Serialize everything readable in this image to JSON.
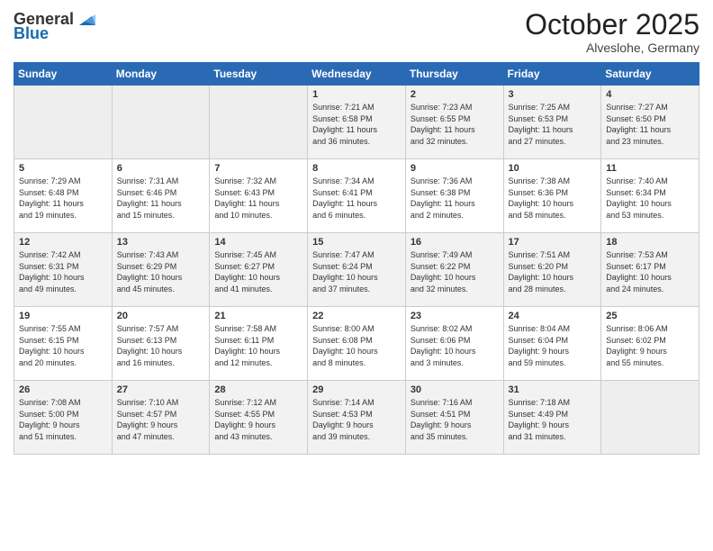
{
  "header": {
    "logo_general": "General",
    "logo_blue": "Blue",
    "month": "October 2025",
    "location": "Alveslohe, Germany"
  },
  "weekdays": [
    "Sunday",
    "Monday",
    "Tuesday",
    "Wednesday",
    "Thursday",
    "Friday",
    "Saturday"
  ],
  "weeks": [
    [
      {
        "day": "",
        "info": ""
      },
      {
        "day": "",
        "info": ""
      },
      {
        "day": "",
        "info": ""
      },
      {
        "day": "1",
        "info": "Sunrise: 7:21 AM\nSunset: 6:58 PM\nDaylight: 11 hours\nand 36 minutes."
      },
      {
        "day": "2",
        "info": "Sunrise: 7:23 AM\nSunset: 6:55 PM\nDaylight: 11 hours\nand 32 minutes."
      },
      {
        "day": "3",
        "info": "Sunrise: 7:25 AM\nSunset: 6:53 PM\nDaylight: 11 hours\nand 27 minutes."
      },
      {
        "day": "4",
        "info": "Sunrise: 7:27 AM\nSunset: 6:50 PM\nDaylight: 11 hours\nand 23 minutes."
      }
    ],
    [
      {
        "day": "5",
        "info": "Sunrise: 7:29 AM\nSunset: 6:48 PM\nDaylight: 11 hours\nand 19 minutes."
      },
      {
        "day": "6",
        "info": "Sunrise: 7:31 AM\nSunset: 6:46 PM\nDaylight: 11 hours\nand 15 minutes."
      },
      {
        "day": "7",
        "info": "Sunrise: 7:32 AM\nSunset: 6:43 PM\nDaylight: 11 hours\nand 10 minutes."
      },
      {
        "day": "8",
        "info": "Sunrise: 7:34 AM\nSunset: 6:41 PM\nDaylight: 11 hours\nand 6 minutes."
      },
      {
        "day": "9",
        "info": "Sunrise: 7:36 AM\nSunset: 6:38 PM\nDaylight: 11 hours\nand 2 minutes."
      },
      {
        "day": "10",
        "info": "Sunrise: 7:38 AM\nSunset: 6:36 PM\nDaylight: 10 hours\nand 58 minutes."
      },
      {
        "day": "11",
        "info": "Sunrise: 7:40 AM\nSunset: 6:34 PM\nDaylight: 10 hours\nand 53 minutes."
      }
    ],
    [
      {
        "day": "12",
        "info": "Sunrise: 7:42 AM\nSunset: 6:31 PM\nDaylight: 10 hours\nand 49 minutes."
      },
      {
        "day": "13",
        "info": "Sunrise: 7:43 AM\nSunset: 6:29 PM\nDaylight: 10 hours\nand 45 minutes."
      },
      {
        "day": "14",
        "info": "Sunrise: 7:45 AM\nSunset: 6:27 PM\nDaylight: 10 hours\nand 41 minutes."
      },
      {
        "day": "15",
        "info": "Sunrise: 7:47 AM\nSunset: 6:24 PM\nDaylight: 10 hours\nand 37 minutes."
      },
      {
        "day": "16",
        "info": "Sunrise: 7:49 AM\nSunset: 6:22 PM\nDaylight: 10 hours\nand 32 minutes."
      },
      {
        "day": "17",
        "info": "Sunrise: 7:51 AM\nSunset: 6:20 PM\nDaylight: 10 hours\nand 28 minutes."
      },
      {
        "day": "18",
        "info": "Sunrise: 7:53 AM\nSunset: 6:17 PM\nDaylight: 10 hours\nand 24 minutes."
      }
    ],
    [
      {
        "day": "19",
        "info": "Sunrise: 7:55 AM\nSunset: 6:15 PM\nDaylight: 10 hours\nand 20 minutes."
      },
      {
        "day": "20",
        "info": "Sunrise: 7:57 AM\nSunset: 6:13 PM\nDaylight: 10 hours\nand 16 minutes."
      },
      {
        "day": "21",
        "info": "Sunrise: 7:58 AM\nSunset: 6:11 PM\nDaylight: 10 hours\nand 12 minutes."
      },
      {
        "day": "22",
        "info": "Sunrise: 8:00 AM\nSunset: 6:08 PM\nDaylight: 10 hours\nand 8 minutes."
      },
      {
        "day": "23",
        "info": "Sunrise: 8:02 AM\nSunset: 6:06 PM\nDaylight: 10 hours\nand 3 minutes."
      },
      {
        "day": "24",
        "info": "Sunrise: 8:04 AM\nSunset: 6:04 PM\nDaylight: 9 hours\nand 59 minutes."
      },
      {
        "day": "25",
        "info": "Sunrise: 8:06 AM\nSunset: 6:02 PM\nDaylight: 9 hours\nand 55 minutes."
      }
    ],
    [
      {
        "day": "26",
        "info": "Sunrise: 7:08 AM\nSunset: 5:00 PM\nDaylight: 9 hours\nand 51 minutes."
      },
      {
        "day": "27",
        "info": "Sunrise: 7:10 AM\nSunset: 4:57 PM\nDaylight: 9 hours\nand 47 minutes."
      },
      {
        "day": "28",
        "info": "Sunrise: 7:12 AM\nSunset: 4:55 PM\nDaylight: 9 hours\nand 43 minutes."
      },
      {
        "day": "29",
        "info": "Sunrise: 7:14 AM\nSunset: 4:53 PM\nDaylight: 9 hours\nand 39 minutes."
      },
      {
        "day": "30",
        "info": "Sunrise: 7:16 AM\nSunset: 4:51 PM\nDaylight: 9 hours\nand 35 minutes."
      },
      {
        "day": "31",
        "info": "Sunrise: 7:18 AM\nSunset: 4:49 PM\nDaylight: 9 hours\nand 31 minutes."
      },
      {
        "day": "",
        "info": ""
      }
    ]
  ]
}
